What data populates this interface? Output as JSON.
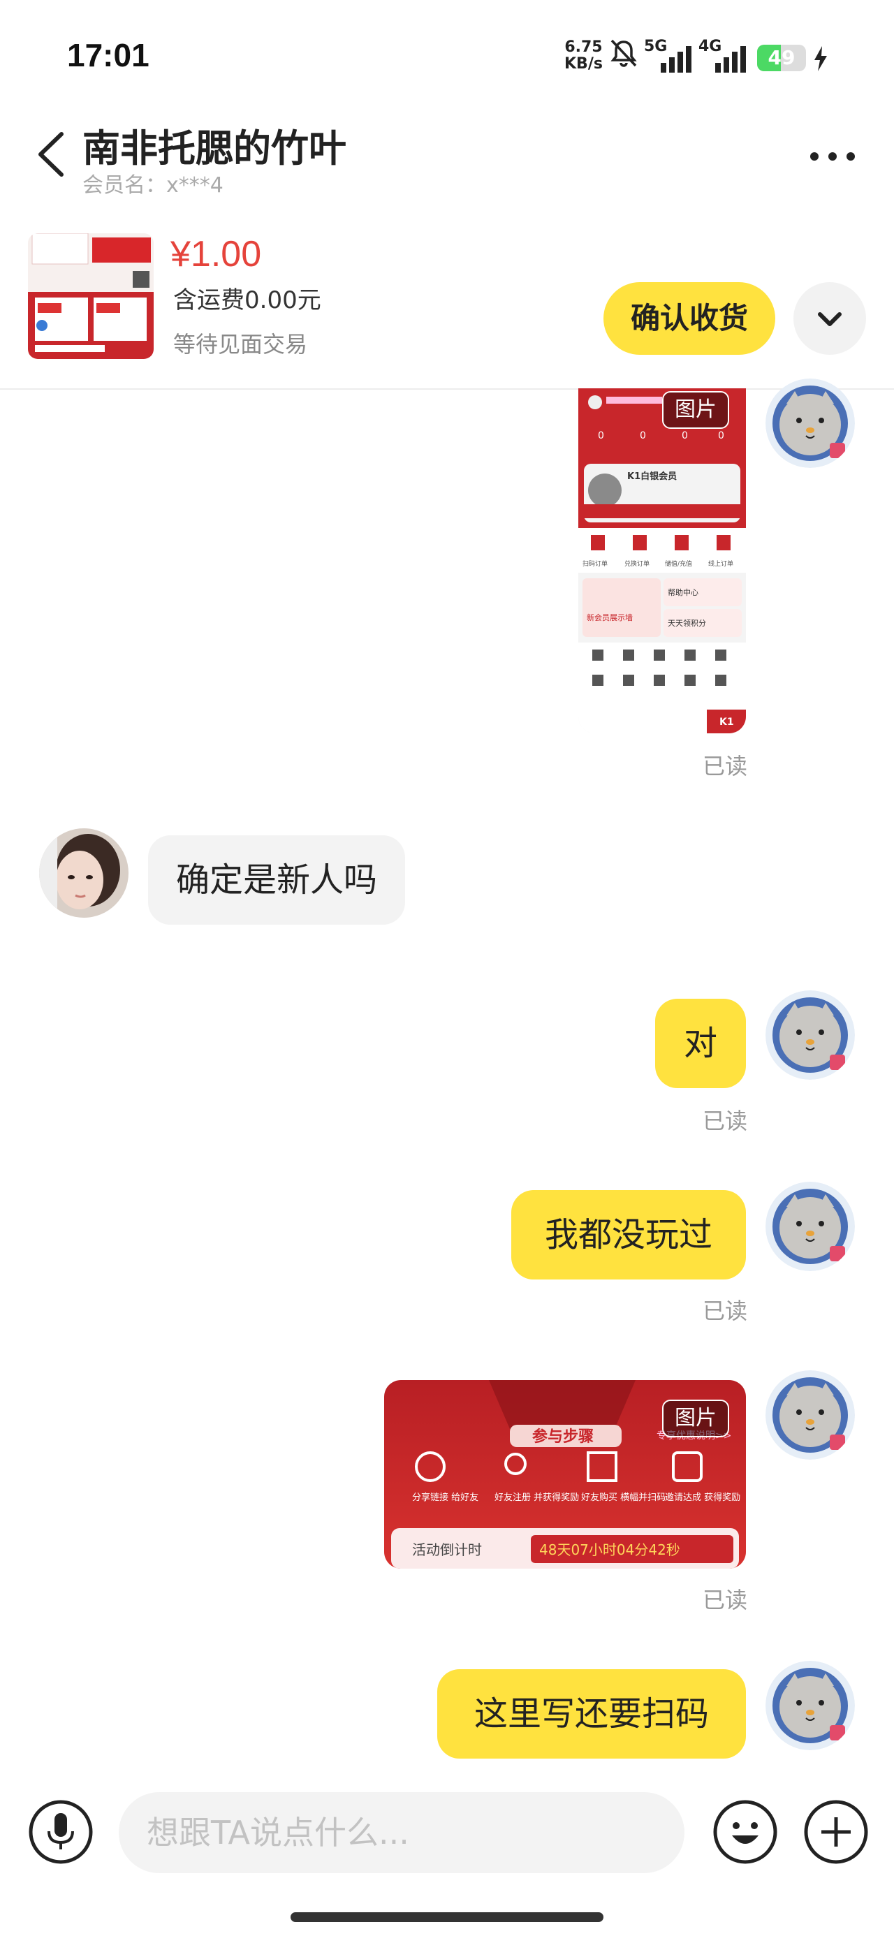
{
  "status_bar": {
    "time": "17:01",
    "speed_value": "6.75",
    "speed_unit": "KB/s",
    "network_1": "5G",
    "network_2": "4G",
    "battery": "49",
    "battery_level": 0.49
  },
  "header": {
    "title": "南非托腮的竹叶",
    "member": "会员名：x***4"
  },
  "product": {
    "price": "¥1.00",
    "shipping": "含运费0.00元",
    "status": "等待见面交易",
    "confirm_label": "确认收货"
  },
  "image_tag": "图片",
  "messages": {
    "img1_read": "已读",
    "msg_them": "确定是新人吗",
    "msg_me_1": "对",
    "msg_me_1_read": "已读",
    "msg_me_2": "我都没玩过",
    "msg_me_2_read": "已读",
    "img2_read": "已读",
    "msg_me_3": "这里写还要扫码"
  },
  "screenshot_1": {
    "k1_title": "K1白银会员",
    "menu": [
      "扫码订单",
      "兑换订单",
      "储值/充值",
      "线上订单"
    ],
    "card_left": "新会员展示墙",
    "card_right_1": "帮助中心",
    "card_right_2": "天天领积分",
    "tab_k1": "K1"
  },
  "screenshot_2": {
    "banner": "参与步骤",
    "rules_link": "专享优惠说明>>",
    "steps": [
      "分享链接\n给好友",
      "好友注册\n并获得奖励",
      "好友购买\n横幅并扫码",
      "邀请达成\n获得奖励"
    ],
    "countdown_label": "活动倒计时",
    "countdown": "48天07小时04分42秒"
  },
  "composer": {
    "placeholder": "想跟TA说点什么..."
  },
  "colors": {
    "accent_yellow": "#ffe23f",
    "price_red": "#e5433b",
    "app_red": "#c8262b"
  }
}
